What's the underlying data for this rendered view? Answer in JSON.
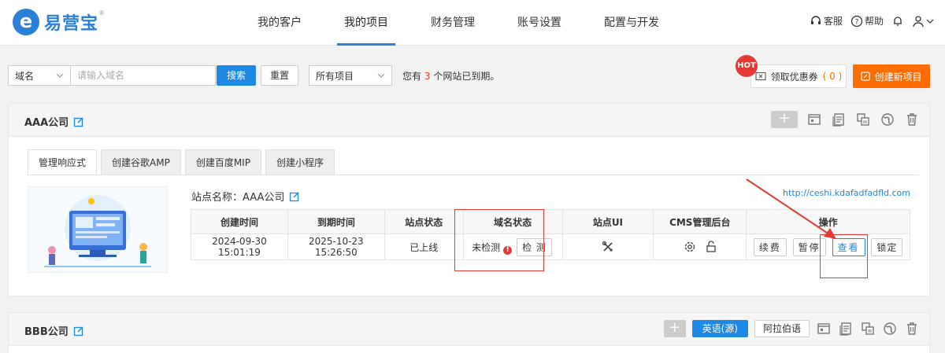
{
  "header": {
    "logo_letter": "e",
    "logo_text": "易营宝",
    "logo_mark": "®",
    "nav": [
      {
        "label": "我的客户"
      },
      {
        "label": "我的项目"
      },
      {
        "label": "财务管理"
      },
      {
        "label": "账号设置"
      },
      {
        "label": "配置与开发"
      }
    ],
    "service_label": "客服",
    "help_label": "帮助"
  },
  "toolbar": {
    "domain_select": "域名",
    "domain_placeholder": "请输入域名",
    "search_label": "搜索",
    "reset_label": "重置",
    "project_select": "所有项目",
    "notice_prefix": "您有 ",
    "notice_count": "3",
    "notice_suffix": " 个网站已到期。",
    "hot_label": "HOT",
    "coupon_label": "领取优惠券",
    "coupon_count": "( 0 )",
    "create_label": "创建新项目"
  },
  "companies": [
    {
      "name": "AAA公司",
      "tabs": [
        "管理响应式",
        "创建谷歌AMP",
        "创建百度MIP",
        "创建小程序"
      ],
      "site_name_label": "站点名称：AAA公司",
      "site_url": "http://ceshi.kdafadfadfld.com",
      "columns": [
        "创建时间",
        "到期时间",
        "站点状态",
        "域名状态",
        "站点UI",
        "CMS管理后台",
        "操作"
      ],
      "row": {
        "created": "2024-09-30 15:01:19",
        "expires": "2025-10-23 15:26:50",
        "site_status": "已上线",
        "domain_status": "未检测",
        "check_label": "检 测",
        "actions": [
          "续费",
          "暂停",
          "查看",
          "锁定"
        ]
      }
    },
    {
      "name": "BBB公司",
      "lang_active": "英语(源)",
      "lang_other": "阿拉伯语"
    }
  ],
  "colors": {
    "brand": "#2a7fd6",
    "orange": "#ff6d00",
    "red": "#e53935",
    "green": "#43a047"
  }
}
